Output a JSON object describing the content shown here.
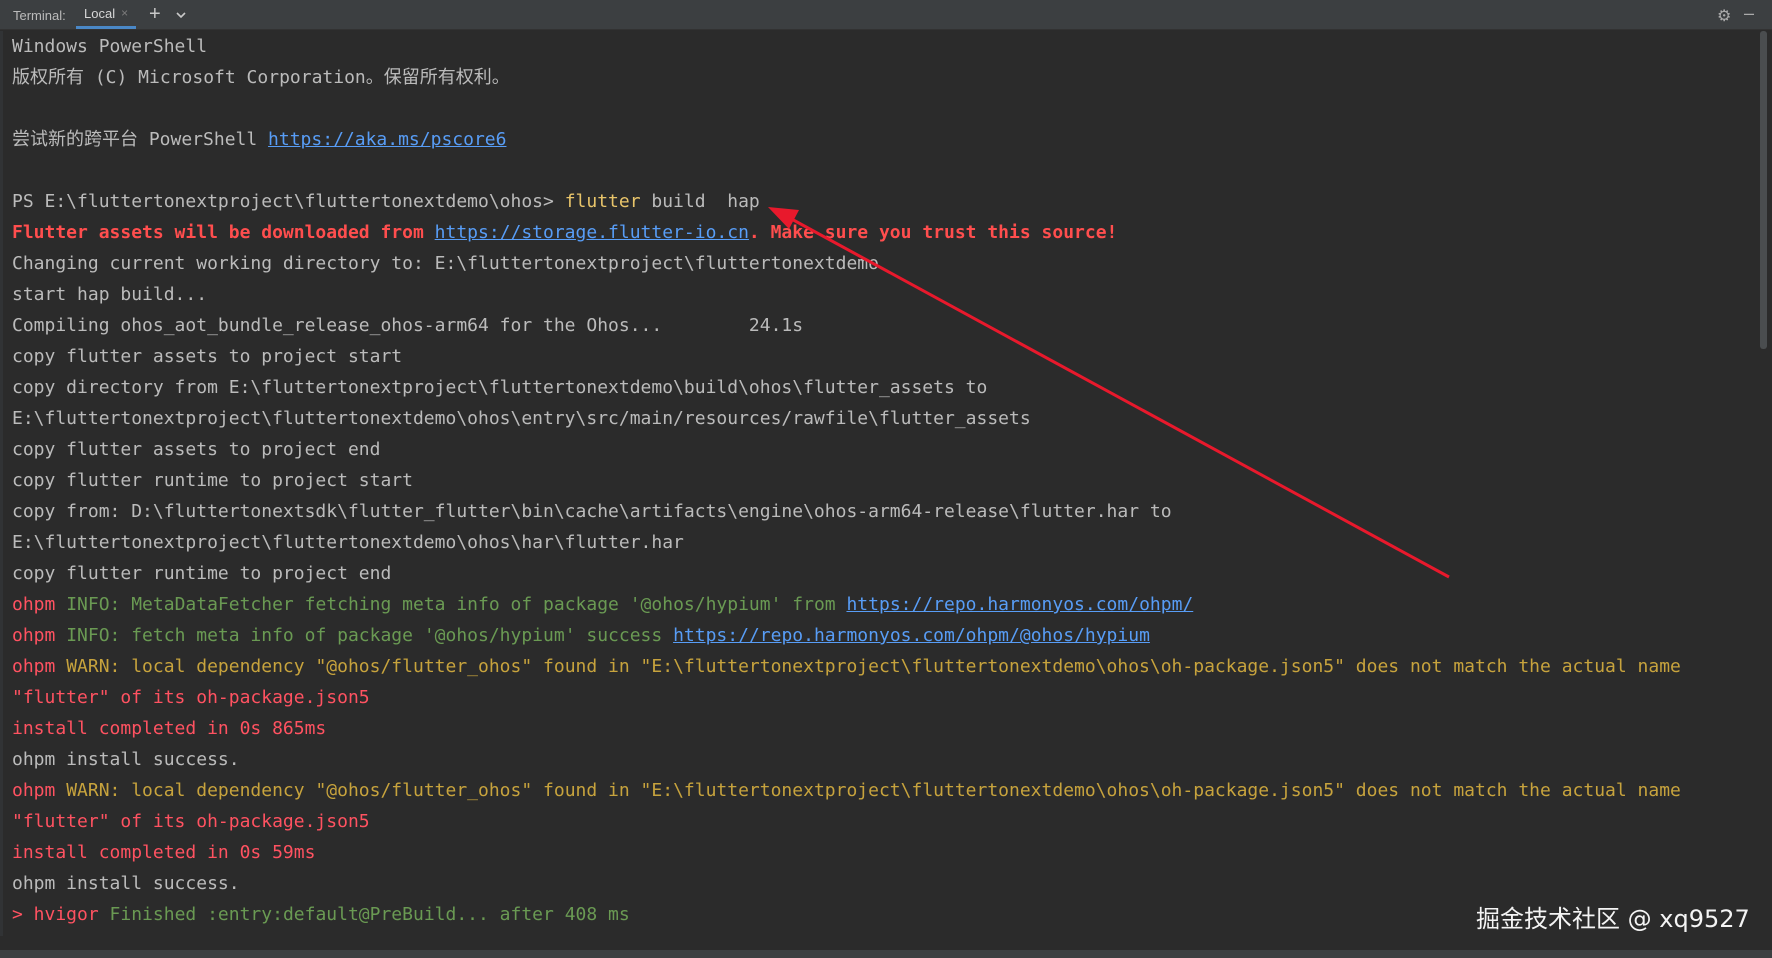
{
  "tabbar": {
    "label": "Terminal:",
    "tab_label": "Local",
    "tab_close": "×",
    "add": "+",
    "icons": [
      "chevron-down-icon",
      "gear-icon",
      "minimize-icon"
    ]
  },
  "colors": {
    "background": "#2b2b2b",
    "text": "#bbbbbb",
    "error_red": "#ff5261",
    "command_yellow": "#e8c46a",
    "warn_orange": "#c7a33d",
    "info_green": "#6a9a53",
    "link_blue": "#589df6",
    "arrow_red": "#e8192c"
  },
  "terminal": {
    "l1": "Windows PowerShell",
    "l2": "版权所有 (C) Microsoft Corporation。保留所有权利。",
    "l4_text": "尝试新的跨平台 PowerShell ",
    "l4_link": "https://aka.ms/pscore6",
    "l6_prompt": "PS E:\\fluttertonextproject\\fluttertonextdemo\\ohos> ",
    "l6_cmd": "flutter",
    "l6_args": " build  hap",
    "l7_a": "Flutter assets will be downloaded from ",
    "l7_link": "https://storage.flutter-io.cn",
    "l7_b": ". Make sure you trust this source!",
    "l8": "Changing current working directory to: E:\\fluttertonextproject\\fluttertonextdemo",
    "l9": "start hap build...",
    "l10": "Compiling ohos_aot_bundle_release_ohos-arm64 for the Ohos...        24.1s",
    "l11": "copy flutter assets to project start",
    "l12": "copy directory from E:\\fluttertonextproject\\fluttertonextdemo\\build\\ohos\\flutter_assets to",
    "l13": "E:\\fluttertonextproject\\fluttertonextdemo\\ohos\\entry\\src/main/resources/rawfile\\flutter_assets",
    "l14": "copy flutter assets to project end",
    "l15": "copy flutter runtime to project start",
    "l16": "copy from: D:\\fluttertonextsdk\\flutter_flutter\\bin\\cache\\artifacts\\engine\\ohos-arm64-release\\flutter.har to",
    "l17": "E:\\fluttertonextproject\\fluttertonextdemo\\ohos\\har\\flutter.har",
    "l18": "copy flutter runtime to project end",
    "l19_a": "ohpm",
    "l19_b": " INFO: MetaDataFetcher fetching meta info of package '@ohos/hypium' from ",
    "l19_link": "https://repo.harmonyos.com/ohpm/",
    "l20_a": "ohpm",
    "l20_b": " INFO: fetch meta info of package '@ohos/hypium' success ",
    "l20_link": "https://repo.harmonyos.com/ohpm/@ohos/hypium",
    "l21_a": "ohpm",
    "l21_b": " WARN: local dependency \"@ohos/flutter_ohos\" found in \"E:\\fluttertonextproject\\fluttertonextdemo\\ohos\\oh-package.json5\" does not match the actual name",
    "l22": "\"flutter\" of its oh-package.json5",
    "l23": "install completed in 0s 865ms",
    "l24": "ohpm install success.",
    "l25_a": "ohpm",
    "l25_b": " WARN: local dependency \"@ohos/flutter_ohos\" found in \"E:\\fluttertonextproject\\fluttertonextdemo\\ohos\\oh-package.json5\" does not match the actual name",
    "l26": "\"flutter\" of its oh-package.json5",
    "l27": "install completed in 0s 59ms",
    "l28": "ohpm install success.",
    "l29_a": "> hvigor ",
    "l29_b": "Finished :entry:default@PreBuild... after 408 ms"
  },
  "watermark": "掘金技术社区 @ xq9527"
}
